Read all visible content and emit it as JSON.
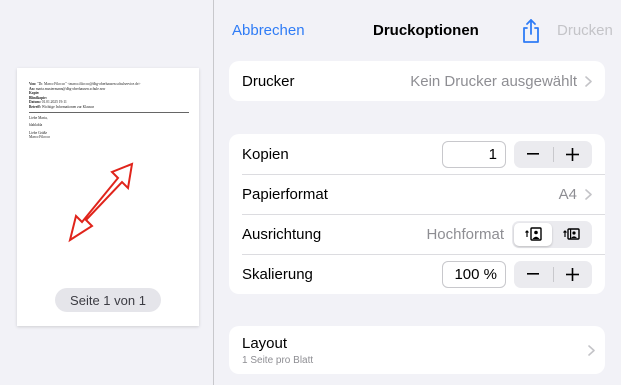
{
  "preview": {
    "email": {
      "from_label": "Von:",
      "from_value": "\"Dr. Marco Filocco\" <marco.filocco@dhg-oberhausen.schulservice.de>",
      "to_label": "An:",
      "to_value": "maria.mustermann@dhg-oberhausen.schule.nrw",
      "cc_label": "Kopie:",
      "bcc_label": "Blindkopie:",
      "date_label": "Datum:",
      "date_value": "01.01.2025 19:11",
      "subject_label": "Betreff:",
      "subject_value": "Wichtige Informationen zur Klausur",
      "greeting": "Liebe Maria,",
      "body": "blablabla",
      "closing": "Liebe Grüße",
      "signature": "Marco Filocco"
    },
    "page_indicator": "Seite 1 von 1"
  },
  "nav": {
    "cancel": "Abbrechen",
    "title": "Druckoptionen",
    "share_icon": "share-icon",
    "print": "Drucken"
  },
  "printer": {
    "label": "Drucker",
    "value": "Kein Drucker ausgewählt"
  },
  "options": {
    "copies": {
      "label": "Kopien",
      "value": "1"
    },
    "paper": {
      "label": "Papierformat",
      "value": "A4"
    },
    "orientation": {
      "label": "Ausrichtung",
      "value": "Hochformat"
    },
    "scale": {
      "label": "Skalierung",
      "value": "100 %"
    }
  },
  "layout": {
    "label": "Layout",
    "sub": "1 Seite pro Blatt"
  },
  "colors": {
    "accent": "#2f7cf6",
    "disabled": "#c4c4c8",
    "annotation_arrow": "#e0241b"
  }
}
